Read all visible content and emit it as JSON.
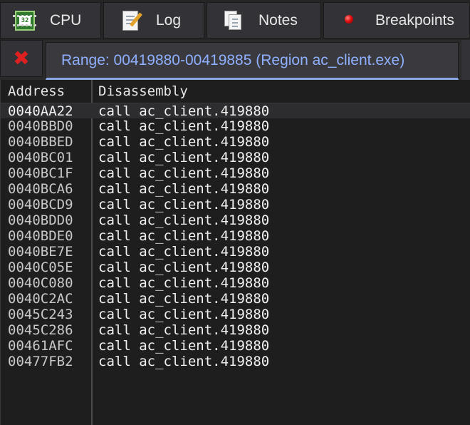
{
  "top_tabs": [
    {
      "label": "CPU",
      "icon": "cpu-chip-icon"
    },
    {
      "label": "Log",
      "icon": "log-pencil-icon"
    },
    {
      "label": "Notes",
      "icon": "notes-icon"
    },
    {
      "label": "Breakpoints",
      "icon": "breakpoint-dot-icon"
    }
  ],
  "chip_text": "32",
  "range_tab": {
    "label": "Range: 00419880-00419885 (Region ac_client.exe)"
  },
  "close_glyph": "✖",
  "table": {
    "headers": {
      "address": "Address",
      "disassembly": "Disassembly"
    },
    "rows": [
      {
        "address": "0040AA22",
        "disassembly": "call ac_client.419880"
      },
      {
        "address": "0040BBD0",
        "disassembly": "call ac_client.419880"
      },
      {
        "address": "0040BBED",
        "disassembly": "call ac_client.419880"
      },
      {
        "address": "0040BC01",
        "disassembly": "call ac_client.419880"
      },
      {
        "address": "0040BC1F",
        "disassembly": "call ac_client.419880"
      },
      {
        "address": "0040BCA6",
        "disassembly": "call ac_client.419880"
      },
      {
        "address": "0040BCD9",
        "disassembly": "call ac_client.419880"
      },
      {
        "address": "0040BDD0",
        "disassembly": "call ac_client.419880"
      },
      {
        "address": "0040BDE0",
        "disassembly": "call ac_client.419880"
      },
      {
        "address": "0040BE7E",
        "disassembly": "call ac_client.419880"
      },
      {
        "address": "0040C05E",
        "disassembly": "call ac_client.419880"
      },
      {
        "address": "0040C080",
        "disassembly": "call ac_client.419880"
      },
      {
        "address": "0040C2AC",
        "disassembly": "call ac_client.419880"
      },
      {
        "address": "0045C243",
        "disassembly": "call ac_client.419880"
      },
      {
        "address": "0045C286",
        "disassembly": "call ac_client.419880"
      },
      {
        "address": "00461AFC",
        "disassembly": "call ac_client.419880"
      },
      {
        "address": "00477FB2",
        "disassembly": "call ac_client.419880"
      }
    ],
    "selected_index": 0
  },
  "colors": {
    "background": "#1e1e1e",
    "tab_background": "#333337",
    "range_tab_text": "#8fb0ff",
    "range_tab_underline": "#8ba7e3",
    "close_icon": "#e02020",
    "text": "#e6e6e6"
  }
}
